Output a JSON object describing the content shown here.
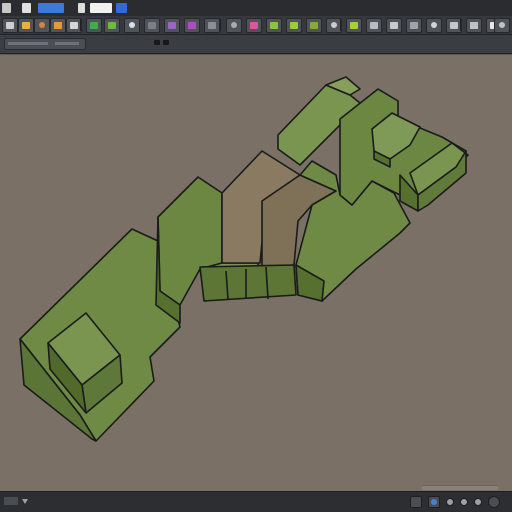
{
  "colors": {
    "top_strip": "#2a2c30",
    "toolbar": "#35383d",
    "viewport": "#7b7066",
    "model_green": "#6f8a45",
    "model_green_light": "#86a05a",
    "model_green_dark": "#56702f",
    "model_floor": "#8a7a62",
    "outline": "#1a1c1a"
  },
  "top_icons": [
    {
      "name": "app-menu-icon",
      "color": "#c8c8c8"
    },
    {
      "name": "file-icon",
      "color": "#e0e0e0"
    },
    {
      "name": "blue-panel-icon",
      "color": "#3b7ad8"
    },
    {
      "name": "view-icon",
      "color": "#dcdcdc"
    },
    {
      "name": "window-icon",
      "color": "#f0f0f0"
    },
    {
      "name": "blue-square-icon",
      "color": "#2f6ad8"
    }
  ],
  "tools": [
    {
      "name": "select-tool-icon",
      "color": "#cfcfcf"
    },
    {
      "name": "move-tool-icon",
      "color": "#e8b040"
    },
    {
      "name": "orbit-tool-icon",
      "color": "#d9823b"
    },
    {
      "name": "paint-tool-icon",
      "color": "#e29a36"
    },
    {
      "name": "layer-tool-icon",
      "color": "#d6d6d6"
    },
    {
      "name": "green-fill-icon",
      "color": "#3fae49"
    },
    {
      "name": "green-block-icon",
      "color": "#6abd3a"
    },
    {
      "name": "blue-grid-icon",
      "color": "#d5e0ee"
    },
    {
      "name": "stripe-icon",
      "color": "#7a8088"
    },
    {
      "name": "purple-icon",
      "color": "#9a66c4"
    },
    {
      "name": "magenta-icon",
      "color": "#b04ac7"
    },
    {
      "name": "gray-icon",
      "color": "#8c9096"
    },
    {
      "name": "frame-icon",
      "color": "#a8adb3"
    },
    {
      "name": "pink-icon",
      "color": "#e0559a"
    },
    {
      "name": "lime-icon",
      "color": "#8bc34a"
    },
    {
      "name": "lime-2-icon",
      "color": "#9ccc3a"
    },
    {
      "name": "olive-icon",
      "color": "#86a83c"
    },
    {
      "name": "outline-icon",
      "color": "#c9cdd2"
    },
    {
      "name": "lime-3-icon",
      "color": "#a3d13a"
    },
    {
      "name": "grid-icon",
      "color": "#b7bcc2"
    },
    {
      "name": "panel-icon",
      "color": "#c7cbd0"
    },
    {
      "name": "frame-2-icon",
      "color": "#a0a5ab"
    },
    {
      "name": "vertical-bars-icon",
      "color": "#d0d4d8"
    },
    {
      "name": "layout-icon",
      "color": "#c4c8cd"
    },
    {
      "name": "square-outline-icon",
      "color": "#bfc3c8"
    },
    {
      "name": "cursor-icon",
      "color": "#e6e6e6"
    },
    {
      "name": "list-icon",
      "color": "#d6dadf"
    },
    {
      "name": "gauge-icon",
      "color": "#c0c4c9"
    }
  ],
  "status_icons": [
    {
      "name": "status-info-icon"
    },
    {
      "name": "status-blue-icon"
    },
    {
      "name": "status-dot-1-icon"
    },
    {
      "name": "status-dot-2-icon"
    },
    {
      "name": "status-dot-3-icon"
    },
    {
      "name": "status-globe-icon"
    }
  ]
}
